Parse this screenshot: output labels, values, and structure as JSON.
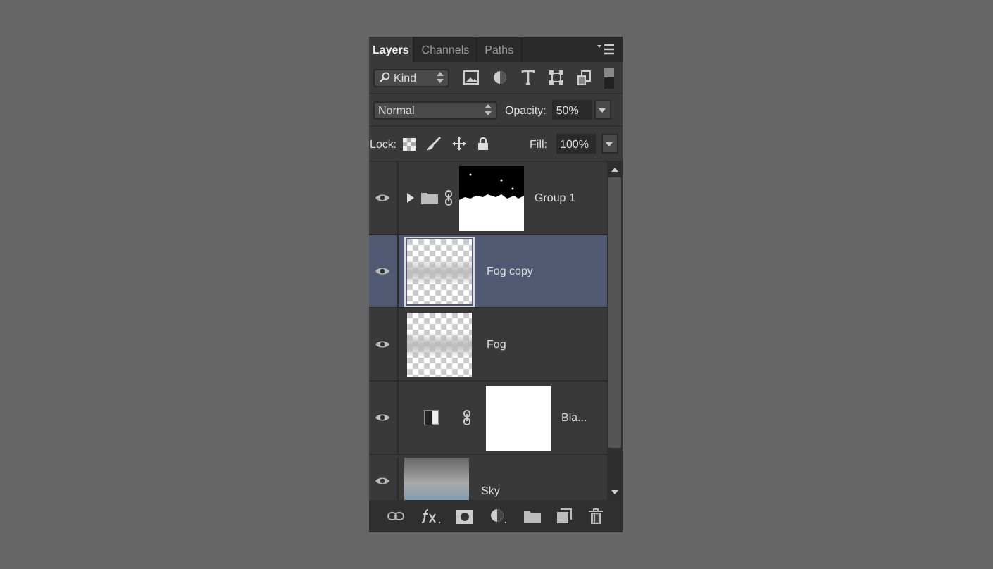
{
  "tabs": [
    {
      "label": "Layers",
      "selected": true
    },
    {
      "label": "Channels",
      "selected": false
    },
    {
      "label": "Paths",
      "selected": false
    }
  ],
  "filter": {
    "label": "Kind"
  },
  "blend_mode": {
    "value": "Normal"
  },
  "opacity": {
    "label": "Opacity:",
    "value": "50%"
  },
  "lock": {
    "label": "Lock:"
  },
  "fill": {
    "label": "Fill:",
    "value": "100%"
  },
  "layers": [
    {
      "name": "Group 1",
      "kind": "group",
      "visible": true,
      "selected": false
    },
    {
      "name": "Fog copy",
      "kind": "pixel",
      "visible": true,
      "selected": true
    },
    {
      "name": "Fog",
      "kind": "pixel",
      "visible": true,
      "selected": false
    },
    {
      "name": "Bla...",
      "kind": "adjustment",
      "visible": true,
      "selected": false
    },
    {
      "name": "Sky",
      "kind": "photo",
      "visible": true,
      "selected": false
    }
  ]
}
